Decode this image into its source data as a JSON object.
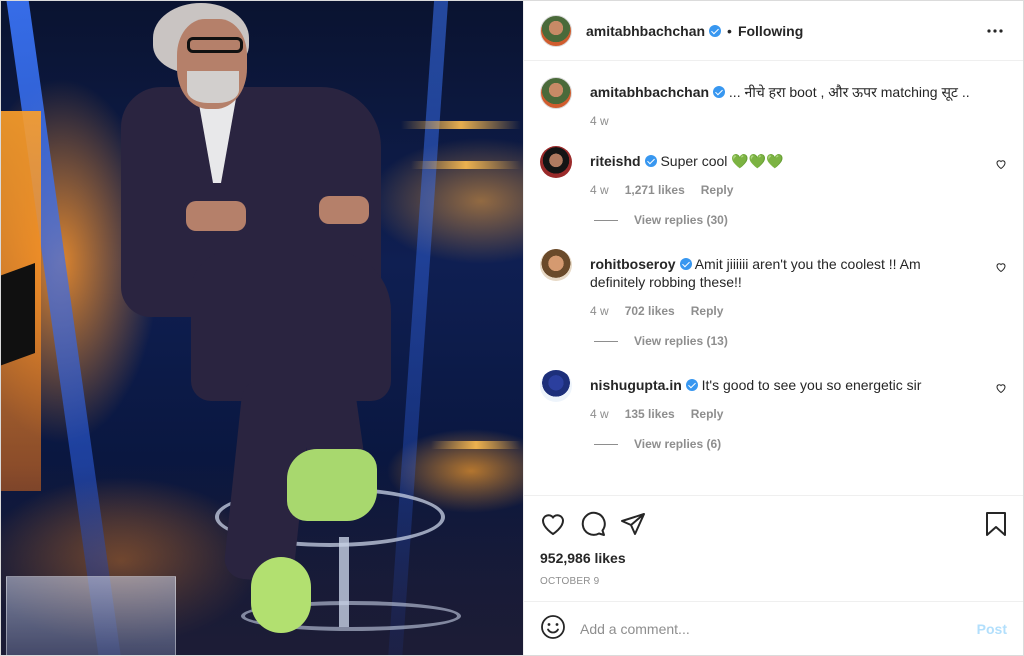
{
  "post": {
    "author": "amitabhbachchan",
    "following_label": "Following",
    "header_separator": "•",
    "caption_text": "... नीचे हरा boot , और ऊपर matching सूट ..",
    "caption_time": "4 w"
  },
  "comments": [
    {
      "username": "riteishd",
      "text": "Super cool 💚💚💚",
      "time": "4 w",
      "likes": "1,271 likes",
      "reply": "Reply",
      "view_replies": "View replies (30)"
    },
    {
      "username": "rohitboseroy",
      "text": "Amit jiiiiii aren't you the coolest !! Am definitely robbing these!!",
      "time": "4 w",
      "likes": "702 likes",
      "reply": "Reply",
      "view_replies": "View replies (13)"
    },
    {
      "username": "nishugupta.in",
      "text": "It's good to see you so energetic sir",
      "time": "4 w",
      "likes": "135 likes",
      "reply": "Reply",
      "view_replies": "View replies (6)"
    }
  ],
  "stats": {
    "likes": "952,986 likes",
    "date": "OCTOBER 9"
  },
  "comment_box": {
    "placeholder": "Add a comment...",
    "post_label": "Post"
  },
  "icons": {
    "like": "heart-icon",
    "comment": "comment-bubble-icon",
    "share": "paper-plane-icon",
    "save": "bookmark-icon",
    "more": "more-options-icon",
    "emoji": "emoji-icon",
    "verified": "verified-badge-icon"
  },
  "colors": {
    "verified": "#3897f0",
    "post_button_disabled": "#b2dffc",
    "muted_text": "#8e8e8e"
  }
}
